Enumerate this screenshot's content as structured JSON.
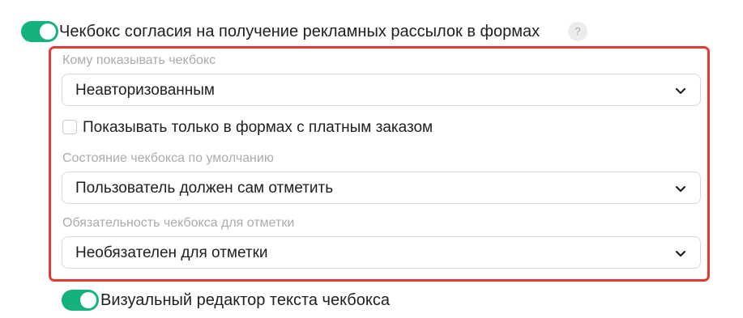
{
  "consent_toggle": {
    "label": "Чекбокс согласия на получение рекламных рассылок в формах",
    "on": true,
    "help_symbol": "?"
  },
  "panel": {
    "show_to": {
      "label": "Кому показывать чекбокс",
      "value": "Неавторизованным"
    },
    "paid_only": {
      "label": "Показывать только в формах с платным заказом",
      "checked": false
    },
    "default_state": {
      "label": "Состояние чекбокса по умолчанию",
      "value": "Пользователь должен сам отметить"
    },
    "required": {
      "label": "Обязательность чекбокса для отметки",
      "value": "Необязателен для отметки"
    }
  },
  "visual_editor_toggle": {
    "label": "Визуальный редактор текста чекбокса",
    "on": true
  },
  "colors": {
    "toggle_on": "#14b37d",
    "highlight_border": "#e53935",
    "muted_label": "#ababab"
  },
  "icons": {
    "select_arrow": "chevron-down-icon",
    "help": "help-icon"
  }
}
